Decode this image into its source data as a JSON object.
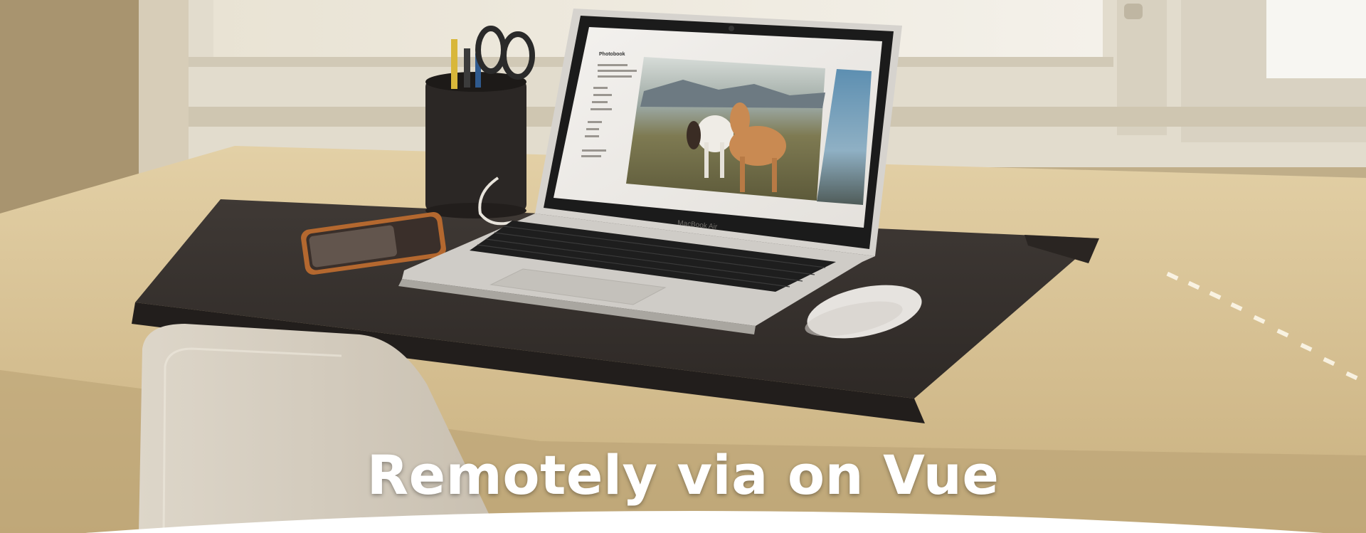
{
  "hero": {
    "title": "Remotely via on Vue",
    "background_image": "laptop-on-desk-photo"
  },
  "laptop_screen": {
    "app_title": "Photobook"
  },
  "laptop_brand": "MacBook Air",
  "colors": {
    "title_text": "#ffffff",
    "desk": "#d9c49a",
    "desk_mat": "#3b3532",
    "wall": "#c8b48d",
    "curve_fill": "#ffffff"
  }
}
